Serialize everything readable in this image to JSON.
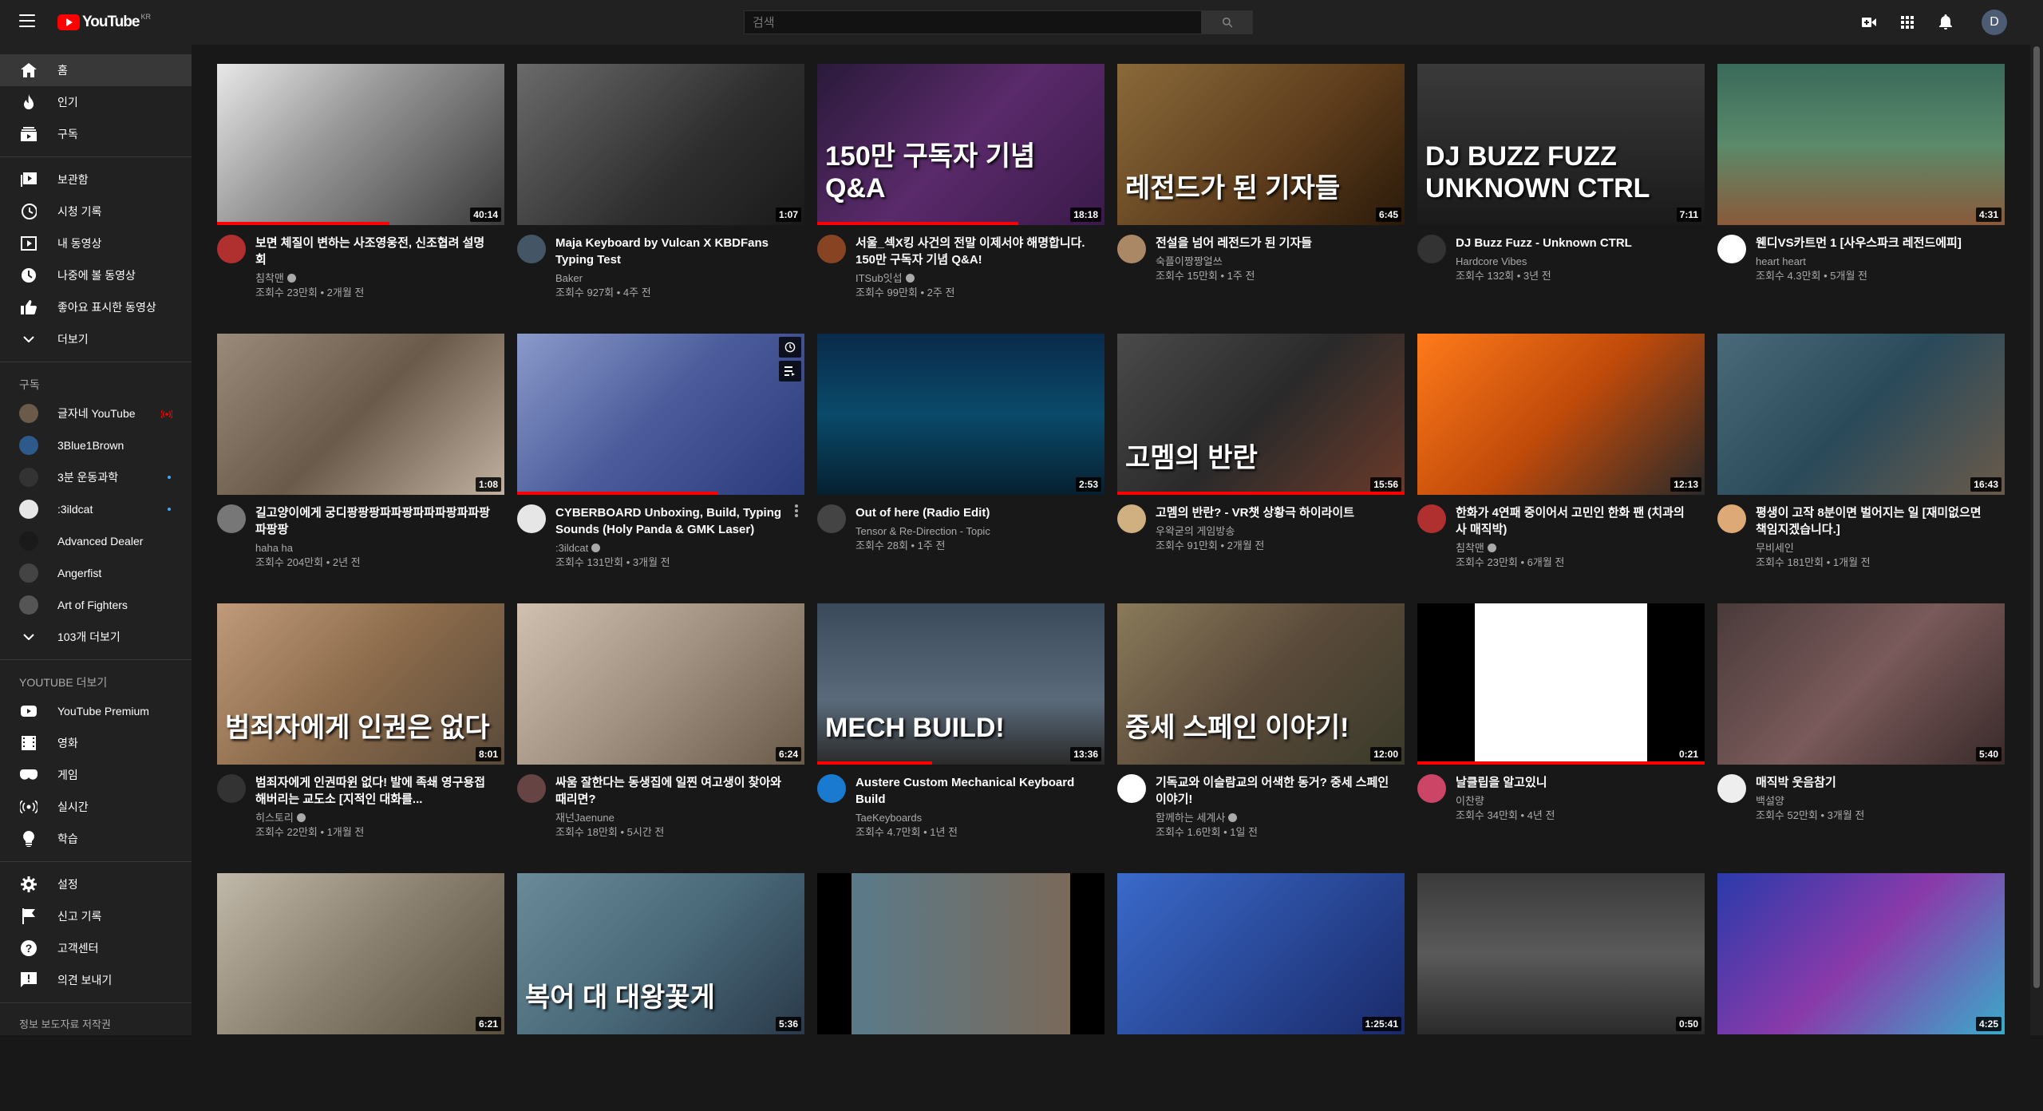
{
  "masthead": {
    "logo_text": "YouTube",
    "logo_region": "KR",
    "search_placeholder": "검색",
    "avatar_letter": "D",
    "icons": [
      "menu-icon",
      "search-icon",
      "create-video-icon",
      "apps-grid-icon",
      "notifications-bell-icon"
    ]
  },
  "sidebar": {
    "main": [
      {
        "label": "홈",
        "icon": "home-icon",
        "active": true
      },
      {
        "label": "인기",
        "icon": "trending-icon"
      },
      {
        "label": "구독",
        "icon": "subscriptions-icon"
      }
    ],
    "library": [
      {
        "label": "보관함",
        "icon": "library-icon"
      },
      {
        "label": "시청 기록",
        "icon": "history-icon"
      },
      {
        "label": "내 동영상",
        "icon": "my-videos-icon"
      },
      {
        "label": "나중에 볼 동영상",
        "icon": "watch-later-icon"
      },
      {
        "label": "좋아요 표시한 동영상",
        "icon": "liked-icon"
      },
      {
        "label": "더보기",
        "icon": "chevron-down-icon"
      }
    ],
    "subs_heading": "구독",
    "subscriptions": [
      {
        "label": "글자네 YouTube",
        "badge": "live",
        "color": "#6b5a4a"
      },
      {
        "label": "3Blue1Brown",
        "badge": "",
        "color": "#2d5a8a"
      },
      {
        "label": "3분 운동과학",
        "badge": "dot",
        "color": "#333333"
      },
      {
        "label": ":3ildcat",
        "badge": "dot",
        "color": "#e6e6e6"
      },
      {
        "label": "Advanced Dealer",
        "badge": "",
        "color": "#1a1a1a"
      },
      {
        "label": "Angerfist",
        "badge": "",
        "color": "#444444"
      },
      {
        "label": "Art of Fighters",
        "badge": "",
        "color": "#555555"
      }
    ],
    "subs_more": "103개 더보기",
    "more_heading": "YOUTUBE 더보기",
    "more": [
      {
        "label": "YouTube Premium",
        "icon": "youtube-premium-icon"
      },
      {
        "label": "영화",
        "icon": "movies-icon"
      },
      {
        "label": "게임",
        "icon": "gaming-icon"
      },
      {
        "label": "실시간",
        "icon": "live-icon"
      },
      {
        "label": "학습",
        "icon": "learning-icon"
      }
    ],
    "settings": [
      {
        "label": "설정",
        "icon": "settings-gear-icon"
      },
      {
        "label": "신고 기록",
        "icon": "flag-icon"
      },
      {
        "label": "고객센터",
        "icon": "help-icon"
      },
      {
        "label": "의견 보내기",
        "icon": "feedback-icon"
      }
    ],
    "footer": "정보 보도자료 저작권"
  },
  "videos": [
    {
      "title": "보면 체질이 변하는 사조영웅전, 신조협려 설명회",
      "channel": "침착맨",
      "verified": true,
      "stats": "조회수 23만회 • 2개월 전",
      "duration": "40:14",
      "progress": 0.6,
      "thumb": "linear-gradient(135deg,#e8e8e8 0%,#9a9a9a 40%,#3a3a3a 100%)",
      "thumb_text": "",
      "avatar": "#b03030"
    },
    {
      "title": "Maja Keyboard by Vulcan X KBDFans Typing Test",
      "channel": "Baker",
      "verified": false,
      "stats": "조회수 927회 • 4주 전",
      "duration": "1:07",
      "progress": 0,
      "thumb": "linear-gradient(135deg,#6a6a6a 0%,#2e2e2e 60%,#1a1a1a 100%)",
      "thumb_text": "",
      "avatar": "#445566"
    },
    {
      "title": "서울_섹X킹 사건의 전말 이제서야 해명합니다. 150만 구독자 기념 Q&A!",
      "channel": "ITSub잇섭",
      "verified": true,
      "stats": "조회수 99만회 • 2주 전",
      "duration": "18:18",
      "progress": 0.7,
      "thumb": "linear-gradient(135deg,#2a1a3a 0%,#5a2a6a 50%,#3a1a4a 100%)",
      "thumb_text": "150만 구독자 기념 Q&A",
      "avatar": "#884422"
    },
    {
      "title": "전설을 넘어 레전드가 된 기자들",
      "channel": "숙플이짱짱얼쓰",
      "verified": false,
      "stats": "조회수 15만회 • 1주 전",
      "duration": "6:45",
      "progress": 0,
      "thumb": "linear-gradient(135deg,#8a6a3a 0%,#5a3a1a 60%,#2a1a0a 100%)",
      "thumb_text": "레전드가 된 기자들",
      "avatar": "#aa8866"
    },
    {
      "title": "DJ Buzz Fuzz - Unknown CTRL",
      "channel": "Hardcore Vibes",
      "verified": false,
      "stats": "조회수 132회 • 3년 전",
      "duration": "7:11",
      "progress": 0,
      "thumb": "linear-gradient(180deg,#3a3a3a 0%,#1a1a1a 100%)",
      "thumb_text": "DJ BUZZ FUZZ UNKNOWN CTRL",
      "avatar": "#333333"
    },
    {
      "title": "웬디VS카트먼 1 [사우스파크 레전드에피]",
      "channel": "heart heart",
      "verified": false,
      "stats": "조회수 4.3만회 • 5개월 전",
      "duration": "4:31",
      "progress": 0,
      "thumb": "linear-gradient(180deg,#3a6a5a 0%,#5a8a6a 50%,#8a5a3a 100%)",
      "thumb_text": "",
      "avatar": "#ffffff"
    },
    {
      "title": "길고양이에게 궁디팡팡팡파파팡파파파팡파파팡파팡팡",
      "channel": "haha ha",
      "verified": false,
      "stats": "조회수 204만회 • 2년 전",
      "duration": "1:08",
      "progress": 0,
      "thumb": "linear-gradient(135deg,#9a8a7a 0%,#6a5a4a 50%,#c0b0a0 100%)",
      "thumb_text": "",
      "avatar": "#777777"
    },
    {
      "title": "CYBERBOARD Unboxing, Build, Typing Sounds (Holy Panda & GMK Laser)",
      "channel": ":3ildcat",
      "verified": true,
      "stats": "조회수 131만회 • 3개월 전",
      "duration": "",
      "progress": 0.7,
      "thumb": "linear-gradient(135deg,#8a9aca 0%,#4a5a9a 50%,#2a3a7a 100%)",
      "thumb_text": "",
      "avatar": "#e6e6e6"
    },
    {
      "title": "Out of here (Radio Edit)",
      "channel": "Tensor & Re-Direction - Topic",
      "verified": false,
      "stats": "조회수 28회 • 1주 전",
      "duration": "2:53",
      "progress": 0,
      "thumb": "linear-gradient(180deg,#0a2a4a 0%,#0a4a6a 50%,#062030 100%)",
      "thumb_text": "",
      "avatar": "#444444"
    },
    {
      "title": "고멤의 반란? - VR챗 상황극 하이라이트",
      "channel": "우왁굳의 게임방송",
      "verified": false,
      "stats": "조회수 91만회 • 2개월 전",
      "duration": "15:56",
      "progress": 1.0,
      "thumb": "linear-gradient(135deg,#4a4a4a 0%,#2a2a2a 50%,#6a3a2a 100%)",
      "thumb_text": "고멤의 반란",
      "avatar": "#d0b080"
    },
    {
      "title": "한화가 4연패 중이어서 고민인 한화 팬 (치과의사 매직박)",
      "channel": "침착맨",
      "verified": true,
      "stats": "조회수 23만회 • 6개월 전",
      "duration": "12:13",
      "progress": 0,
      "thumb": "linear-gradient(135deg,#ff7a1a 0%,#c04a0a 50%,#2a2a2a 100%)",
      "thumb_text": "",
      "avatar": "#b03030"
    },
    {
      "title": "평생이 고작 8분이면 벌어지는 일 [재미없으면 책임지겠습니다.]",
      "channel": "무비세인",
      "verified": false,
      "stats": "조회수 181만회 • 1개월 전",
      "duration": "16:43",
      "progress": 0,
      "thumb": "linear-gradient(135deg,#4a6a7a 0%,#2a4a5a 50%,#6a5a4a 100%)",
      "thumb_text": "",
      "avatar": "#ddaa77"
    },
    {
      "title": "범죄자에게 인권따윈 없다! 발에 족쇄 영구용접해버리는 교도소 [지적인 대화를...",
      "channel": "히스토리",
      "verified": true,
      "stats": "조회수 22만회 • 1개월 전",
      "duration": "8:01",
      "progress": 0,
      "thumb": "linear-gradient(135deg,#c09a7a 0%,#8a6a4a 50%,#5a4a3a 100%)",
      "thumb_text": "범죄자에게 인권은 없다",
      "avatar": "#333333"
    },
    {
      "title": "싸움 잘한다는 동생집에 일찐 여고생이 찾아와 때리면?",
      "channel": "재넌Jaenune",
      "verified": false,
      "stats": "조회수 18만회 • 5시간 전",
      "duration": "6:24",
      "progress": 0,
      "thumb": "linear-gradient(135deg,#d0c0b0 0%,#a09080 50%,#6a5a4a 100%)",
      "thumb_text": "",
      "avatar": "#664444"
    },
    {
      "title": "Austere Custom Mechanical Keyboard Build",
      "channel": "TaeKeyboards",
      "verified": false,
      "stats": "조회수 4.7만회 • 1년 전",
      "duration": "13:36",
      "progress": 0.4,
      "thumb": "linear-gradient(180deg,#3a4a5a 0%,#5a6a7a 60%,#2a2a2a 100%)",
      "thumb_text": "MECH BUILD!",
      "avatar": "#1a7ad0"
    },
    {
      "title": "기독교와 이슬람교의 어색한 동거? 중세 스페인 이야기!",
      "channel": "함께하는 세계사",
      "verified": true,
      "stats": "조회수 1.6만회 • 1일 전",
      "duration": "12:00",
      "progress": 0,
      "thumb": "linear-gradient(135deg,#8a7a5a 0%,#5a4a3a 50%,#3a3a2a 100%)",
      "thumb_text": "중세 스페인 이야기!",
      "avatar": "#ffffff"
    },
    {
      "title": "날클립을 알고있니",
      "channel": "이찬량",
      "verified": false,
      "stats": "조회수 34만회 • 4년 전",
      "duration": "0:21",
      "progress": 1.0,
      "thumb": "linear-gradient(90deg,#000 0%,#000 20%,#ffffff 20%,#ffffff 80%,#000 80%)",
      "thumb_text": "",
      "avatar": "#cc4466"
    },
    {
      "title": "매직박 웃음참기",
      "channel": "백설양",
      "verified": false,
      "stats": "조회수 52만회 • 3개월 전",
      "duration": "5:40",
      "progress": 0,
      "thumb": "linear-gradient(135deg,#4a3a3a 0%,#7a5a5a 50%,#3a2a2a 100%)",
      "thumb_text": "",
      "avatar": "#eeeeee"
    },
    {
      "title": "",
      "channel": "",
      "verified": false,
      "stats": "",
      "duration": "6:21",
      "progress": 0,
      "thumb": "linear-gradient(135deg,#c0b8a8 0%,#8a8070 50%,#5a5040 100%)",
      "thumb_text": "",
      "avatar": ""
    },
    {
      "title": "",
      "channel": "",
      "verified": false,
      "stats": "",
      "duration": "5:36",
      "progress": 0,
      "thumb": "linear-gradient(135deg,#6a8a9a 0%,#4a6a7a 50%,#2a3a4a 100%)",
      "thumb_text": "복어 대 대왕꽃게",
      "avatar": ""
    },
    {
      "title": "",
      "channel": "",
      "verified": false,
      "stats": "",
      "duration": "",
      "progress": 0,
      "thumb": "linear-gradient(90deg,#000 0%,#000 12%,#5a7a8a 12%,#7a6a5a 88%,#000 88%)",
      "thumb_text": "",
      "avatar": ""
    },
    {
      "title": "",
      "channel": "",
      "verified": false,
      "stats": "",
      "duration": "1:25:41",
      "progress": 0,
      "thumb": "linear-gradient(135deg,#3a6aca 0%,#2a4a9a 50%,#1a2a6a 100%)",
      "thumb_text": "",
      "avatar": ""
    },
    {
      "title": "",
      "channel": "",
      "verified": false,
      "stats": "",
      "duration": "0:50",
      "progress": 0,
      "thumb": "linear-gradient(180deg,#3a3a3a 0%,#5a5a5a 50%,#2a2a2a 100%)",
      "thumb_text": "",
      "avatar": ""
    },
    {
      "title": "",
      "channel": "",
      "verified": false,
      "stats": "",
      "duration": "4:25",
      "progress": 0,
      "thumb": "linear-gradient(135deg,#2a3aaa 0%,#8a3aaa 50%,#3aaaca 100%)",
      "thumb_text": "",
      "avatar": ""
    }
  ],
  "icon_names": {
    "more": "more-vert-icon",
    "watch_later": "watch-later-icon",
    "queue": "add-to-queue-icon"
  }
}
